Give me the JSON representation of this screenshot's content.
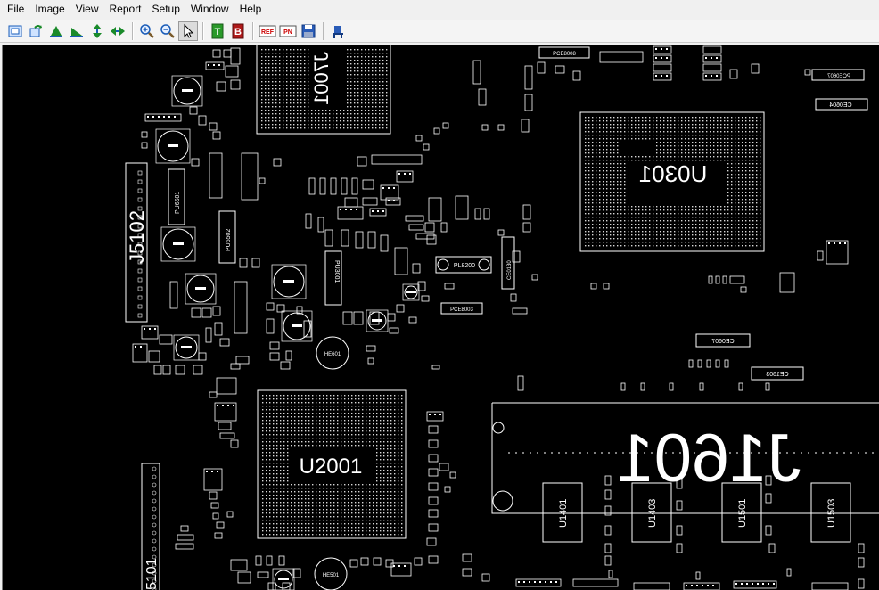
{
  "menu": [
    "File",
    "Image",
    "View",
    "Report",
    "Setup",
    "Window",
    "Help"
  ],
  "toolbar": {
    "buttons": [
      "fit-window-icon",
      "rotate-icon",
      "flip-up-icon",
      "flip-down-icon",
      "mirror-vertical-icon",
      "mirror-horizontal-icon",
      "zoom-in-icon",
      "zoom-out-icon",
      "select-pointer-icon",
      "top-side-icon",
      "bottom-side-icon",
      "ref-icon",
      "pn-icon",
      "save-icon",
      "export-icon"
    ],
    "top_label": "T",
    "bottom_label": "B",
    "ref_label": "REF",
    "pn_label": "PN"
  },
  "board": {
    "components": [
      {
        "id": "j7001",
        "label": "J7001"
      },
      {
        "id": "u0301",
        "label": "U0301"
      },
      {
        "id": "j5102",
        "label": "J5102"
      },
      {
        "id": "u2001",
        "label": "U2001"
      },
      {
        "id": "j1601",
        "label": "J1601"
      },
      {
        "id": "u1401",
        "label": "U1401"
      },
      {
        "id": "u1403",
        "label": "U1403"
      },
      {
        "id": "u1501",
        "label": "U1501"
      },
      {
        "id": "u1503",
        "label": "U1503"
      },
      {
        "id": "j5101",
        "label": "5101"
      },
      {
        "id": "ce0607",
        "label": "CE0607"
      },
      {
        "id": "ce1603",
        "label": "CE1603"
      },
      {
        "id": "ce0604",
        "label": "CE0604"
      },
      {
        "id": "pce0607",
        "label": "PCE0607"
      },
      {
        "id": "pce8008",
        "label": "PCE8008"
      },
      {
        "id": "pl8200",
        "label": "PL8200"
      },
      {
        "id": "ce0130",
        "label": "CE0130"
      },
      {
        "id": "pu3001",
        "label": "PU3001"
      },
      {
        "id": "pu6501",
        "label": "PU6501"
      },
      {
        "id": "pu6502",
        "label": "PU6502"
      },
      {
        "id": "pce8003",
        "label": "PCE8003"
      },
      {
        "id": "he601",
        "label": "HE601"
      },
      {
        "id": "he501",
        "label": "HE501"
      }
    ]
  }
}
